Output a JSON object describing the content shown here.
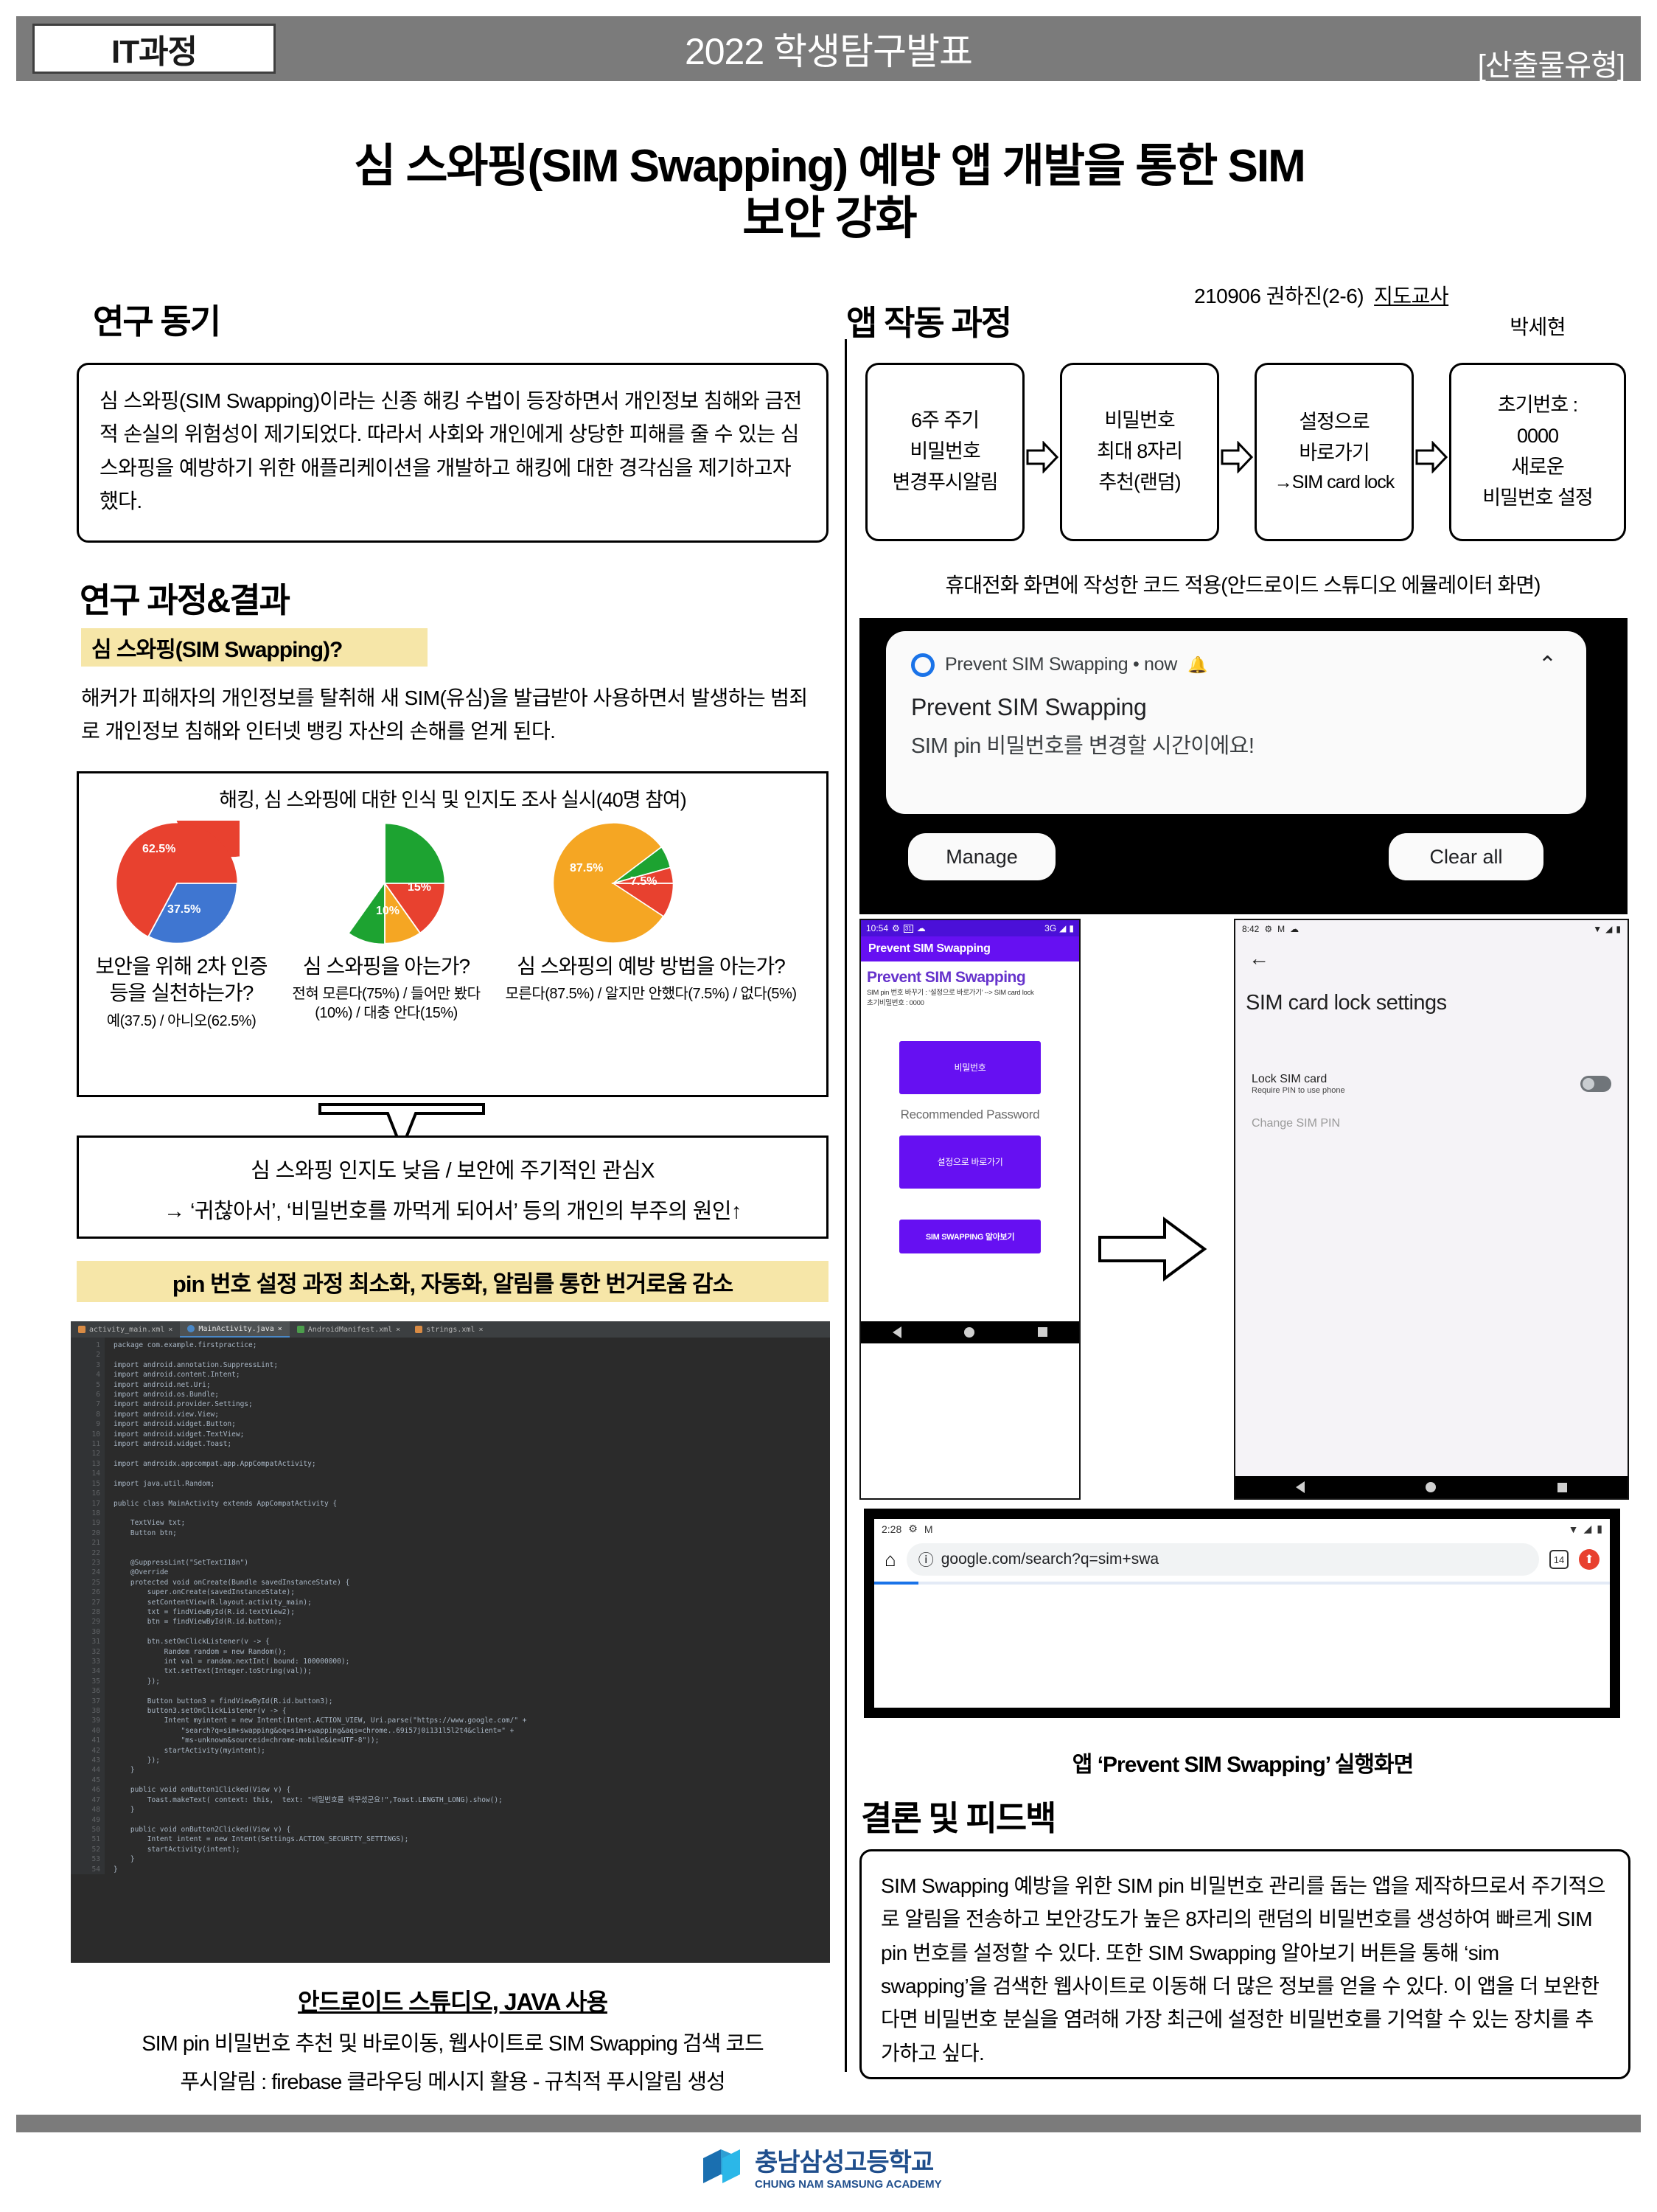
{
  "header": {
    "course_badge": "IT과정",
    "title": "2022 학생탐구발표",
    "type_label": "[산출물유형]"
  },
  "main_title_line1": "심 스와핑(SIM Swapping) 예방 앱 개발을 통한 SIM",
  "main_title_line2": "보안 강화",
  "author": {
    "student": "210906  권하진(2-6)",
    "teacher_label": "지도교사",
    "teacher_name": "박세현"
  },
  "sections": {
    "motivation_heading": "연구 동기",
    "motivation_body": "심 스와핑(SIM Swapping)이라는 신종 해킹 수법이 등장하면서 개인정보 침해와 금전적 손실의 위험성이 제기되었다. 따라서 사회와 개인에게 상당한 피해를 줄 수 있는 심 스와핑을 예방하기 위한 애플리케이션을 개발하고 해킹에 대한 경각심을 제기하고자 했다.",
    "process_heading": "연구 과정&결과",
    "definition_tag": "심 스와핑(SIM Swapping)?",
    "definition_body": "해커가 피해자의 개인정보를 탈취해 새 SIM(유심)을 발급받아 사용하면서 발생하는 범죄로 개인정보 침해와 인터넷 뱅킹 자산의 손해를 얻게 된다.",
    "survey_conclusion_line1": "심 스와핑 인지도 낮음 / 보안에 주기적인 관심X",
    "survey_conclusion_line2": "→ ‘귀찮아서’, ‘비밀번호를 까먹게 되어서’ 등의 개인의 부주의 원인↑",
    "solution_tag": "pin 번호 설정 과정 최소화, 자동화, 알림를 통한 번거로움 감소",
    "code_caption_title": "안드로이드 스튜디오, JAVA 사용",
    "code_caption_l1": "SIM pin 비밀번호 추천 및 바로이동, 웹사이트로 SIM Swapping 검색 코드",
    "code_caption_l2": "푸시알림 : firebase 클라우딩 메시지 활용 - 규칙적 푸시알림 생성",
    "app_flow_heading": "앱 작동 과정",
    "emulator_caption": "휴대전화 화면에 작성한 코드 적용(안드로이드 스튜디오 에뮬레이터 화면)",
    "app_run_caption": "앱 ‘Prevent SIM Swapping’ 실행화면",
    "conclusion_heading": "결론 및 피드백",
    "conclusion_body": "SIM Swapping 예방을 위한 SIM pin 비밀번호 관리를 돕는 앱을 제작하므로서 주기적으로 알림을 전송하고 보안강도가 높은 8자리의 랜덤의 비밀번호를 생성하여 빠르게 SIM pin 번호를 설정할 수 있다. 또한 SIM Swapping 알아보기 버튼을 통해 ‘sim swapping’을 검색한 웹사이트로 이동해 더 많은 정보를 얻을 수 있다. 이 앱을 더 보완한다면 비밀번호 분실을 염려해 가장 최근에 설정한 비밀번호를 기억할 수 있는 장치를 추가하고 싶다."
  },
  "flow_steps": [
    {
      "lines": [
        "6주 주기",
        "비밀번호",
        "변경푸시알림"
      ]
    },
    {
      "lines": [
        "비밀번호",
        "최대 8자리",
        "추천(랜덤)"
      ]
    },
    {
      "lines": [
        "설정으로",
        "바로가기",
        "→SIM card lock"
      ]
    },
    {
      "lines": [
        "초기번호 :",
        "0000",
        "새로운",
        "비밀번호 설정"
      ]
    }
  ],
  "chart_data": [
    {
      "type": "pie",
      "title": "보안을 위해 2차 인증 등을 실천하는가?",
      "subtitle": "예(37.5) / 아니오(62.5%)",
      "categories": [
        "아니오",
        "예"
      ],
      "values": [
        62.5,
        37.5
      ],
      "labels": [
        "62.5%",
        "37.5%"
      ],
      "colors": [
        "#e8412f",
        "#3f76d1"
      ],
      "legend": "none"
    },
    {
      "type": "pie",
      "title": "심 스와핑을 아는가?",
      "subtitle": "전혀 모른다(75%) / 들어만 봤다 (10%) / 대충 안다(15%)",
      "categories": [
        "전혀 모른다",
        "대충 안다",
        "들어만 봤다"
      ],
      "values": [
        75,
        15,
        10
      ],
      "labels": [
        "75%",
        "15%",
        "10%"
      ],
      "colors": [
        "#1da331",
        "#e8412f",
        "#f5a623"
      ],
      "legend": "none"
    },
    {
      "type": "pie",
      "title": "심 스와핑의 예방 방법을 아는가?",
      "subtitle": "모른다(87.5%) / 알지만 안했다(7.5%) / 없다(5%)",
      "categories": [
        "모른다",
        "알지만 안했다",
        "없다"
      ],
      "values": [
        87.5,
        7.5,
        5
      ],
      "labels": [
        "87.5%",
        "7.5%",
        ""
      ],
      "colors": [
        "#f5a623",
        "#e8412f",
        "#1da331"
      ],
      "legend": "none"
    }
  ],
  "survey_frame_title": "해킹, 심 스와핑에 대한 인식 및 인지도 조사 실시(40명 참여)",
  "code": {
    "tabs": [
      {
        "name": "activity_main.xml",
        "active": false
      },
      {
        "name": "MainActivity.java",
        "active": true
      },
      {
        "name": "AndroidManifest.xml",
        "active": false
      },
      {
        "name": "strings.xml",
        "active": false
      }
    ],
    "text": "package com.example.firstpractice;\n\nimport android.annotation.SuppressLint;\nimport android.content.Intent;\nimport android.net.Uri;\nimport android.os.Bundle;\nimport android.provider.Settings;\nimport android.view.View;\nimport android.widget.Button;\nimport android.widget.TextView;\nimport android.widget.Toast;\n\nimport androidx.appcompat.app.AppCompatActivity;\n\nimport java.util.Random;\n\npublic class MainActivity extends AppCompatActivity {\n\n    TextView txt;\n    Button btn;\n\n\n    @SuppressLint(\"SetTextI18n\")\n    @Override\n    protected void onCreate(Bundle savedInstanceState) {\n        super.onCreate(savedInstanceState);\n        setContentView(R.layout.activity_main);\n        txt = findViewById(R.id.textView2);\n        btn = findViewById(R.id.button);\n\n        btn.setOnClickListener(v -> {\n            Random random = new Random();\n            int val = random.nextInt( bound: 100000000);\n            txt.setText(Integer.toString(val));\n        });\n\n        Button button3 = findViewById(R.id.button3);\n        button3.setOnClickListener(v -> {\n            Intent myintent = new Intent(Intent.ACTION_VIEW, Uri.parse(\"https://www.google.com/\" +\n                \"search?q=sim+swapping&oq=sim+swapping&aqs=chrome..69i57j0i131l5l2t4&client=\" +\n                \"ms-unknown&sourceid=chrome-mobile&ie=UTF-8\"));\n            startActivity(myintent);\n        });\n    }\n\n    public void onButton1Clicked(View v) {\n        Toast.makeText( context: this,  text: \"비밀번호를 바꾸셨군요!\",Toast.LENGTH_LONG).show();\n    }\n\n    public void onButton2Clicked(View v) {\n        Intent intent = new Intent(Settings.ACTION_SECURITY_SETTINGS);\n        startActivity(intent);\n    }\n}"
  },
  "notification": {
    "app_line": "Prevent SIM Swapping • now",
    "title": "Prevent SIM Swapping",
    "body": "SIM pin 비밀번호를 변경할 시간이에요!",
    "manage": "Manage",
    "clear_all": "Clear all"
  },
  "app_screen": {
    "status_time": "10:54",
    "status_net": "3G",
    "appbar_title": "Prevent SIM Swapping",
    "heading": "Prevent SIM Swapping",
    "sub_l1": "SIM pin 번호 바꾸기 : ‘설정으로 바로가기’ --> SIM card lock",
    "sub_l2": "초기비밀번호 : 0000",
    "btn_password": "비밀번호",
    "recommended_label": "Recommended Password",
    "btn_settings": "설정으로 바로가기",
    "btn_learn": "SIM SWAPPING 알아보기"
  },
  "settings_screen": {
    "status_time": "8:42",
    "title": "SIM card lock settings",
    "lock_title": "Lock SIM card",
    "lock_sub": "Require PIN to use phone",
    "change_pin": "Change SIM PIN"
  },
  "browser_screen": {
    "status_time": "2:28",
    "url": "google.com/search?q=sim+swa",
    "tab_count": "14"
  },
  "footer": {
    "school_kr": "충남삼성고등학교",
    "school_en": "CHUNG NAM SAMSUNG ACADEMY"
  }
}
